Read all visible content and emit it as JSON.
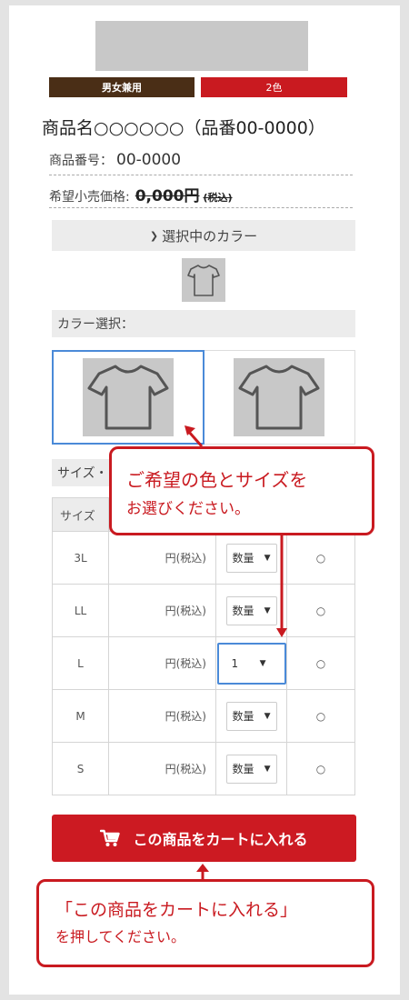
{
  "product": {
    "badges": [
      "男女兼用",
      "2色"
    ],
    "name": "商品名○○○○○○（品番00-0000）",
    "number_label": "商品番号：",
    "number_value": "00-0000",
    "price_label": "希望小売価格:",
    "price_value": "0,000円",
    "price_tax": "(税込)"
  },
  "color": {
    "selected_header": "選択中のカラー",
    "select_label": "カラー選択："
  },
  "size": {
    "select_label": "サイズ・",
    "header": "サイズ",
    "rows": [
      {
        "size": "3L",
        "price": "円(税込)",
        "qty": "数量",
        "mark": "○"
      },
      {
        "size": "LL",
        "price": "円(税込)",
        "qty": "数量",
        "mark": "○"
      },
      {
        "size": "L",
        "price": "円(税込)",
        "qty": "1",
        "mark": "○"
      },
      {
        "size": "M",
        "price": "円(税込)",
        "qty": "数量",
        "mark": "○"
      },
      {
        "size": "S",
        "price": "円(税込)",
        "qty": "数量",
        "mark": "○"
      }
    ]
  },
  "cart": {
    "label": "この商品をカートに入れる",
    "icon": "cart-icon"
  },
  "callouts": {
    "color_size_line1": "ご希望の色とサイズを",
    "color_size_line2": "お選びください。",
    "cart_line1": "「この商品をカートに入れる」",
    "cart_line2": "を押してください。"
  },
  "colors": {
    "accent": "#c91a20",
    "brown": "#4a2e16",
    "select_blue": "#4a8ad8"
  }
}
